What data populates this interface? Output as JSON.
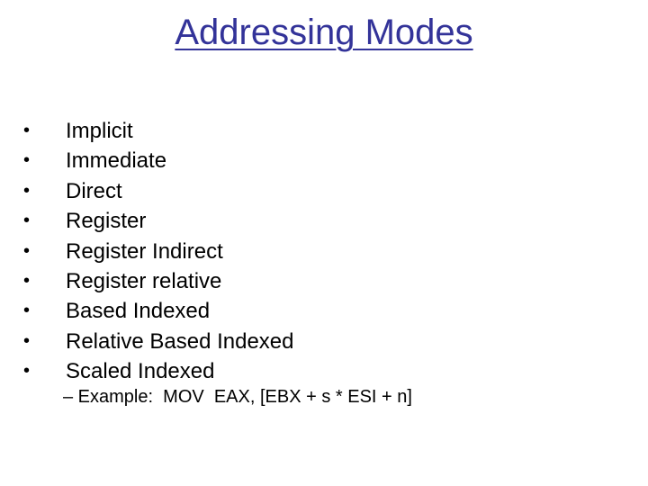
{
  "slide": {
    "title": "Addressing Modes",
    "bullet_glyph": "•",
    "items": [
      "Implicit",
      "Immediate",
      "Direct",
      "Register",
      "Register Indirect",
      "Register relative",
      "Based Indexed",
      "Relative Based Indexed",
      "Scaled Indexed"
    ],
    "sub_item": "– Example:  MOV  EAX, [EBX + s * ESI + n]",
    "colors": {
      "title": "#333399",
      "text": "#000000",
      "background": "#ffffff"
    }
  }
}
